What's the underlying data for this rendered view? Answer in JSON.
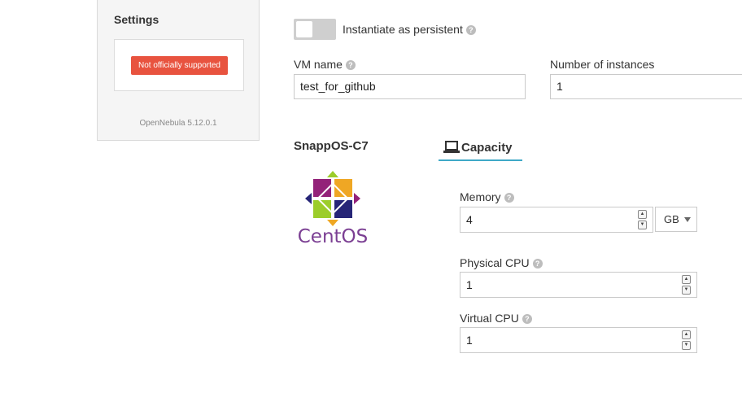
{
  "settings_panel": {
    "title": "Settings",
    "support_badge": "Not officially supported",
    "version": "OpenNebula 5.12.0.1"
  },
  "persistent": {
    "label": "Instantiate as persistent",
    "enabled": false
  },
  "vm_name": {
    "label": "VM name",
    "value": "test_for_github"
  },
  "instances": {
    "label": "Number of instances",
    "value": "1"
  },
  "template": {
    "name": "SnappOS-C7",
    "logo_text": "CentOS"
  },
  "capacity_tab": {
    "label": "Capacity"
  },
  "memory": {
    "label": "Memory",
    "value": "4",
    "unit": "GB"
  },
  "physical_cpu": {
    "label": "Physical CPU",
    "value": "1"
  },
  "virtual_cpu": {
    "label": "Virtual CPU",
    "value": "1"
  },
  "help_icon": "?"
}
